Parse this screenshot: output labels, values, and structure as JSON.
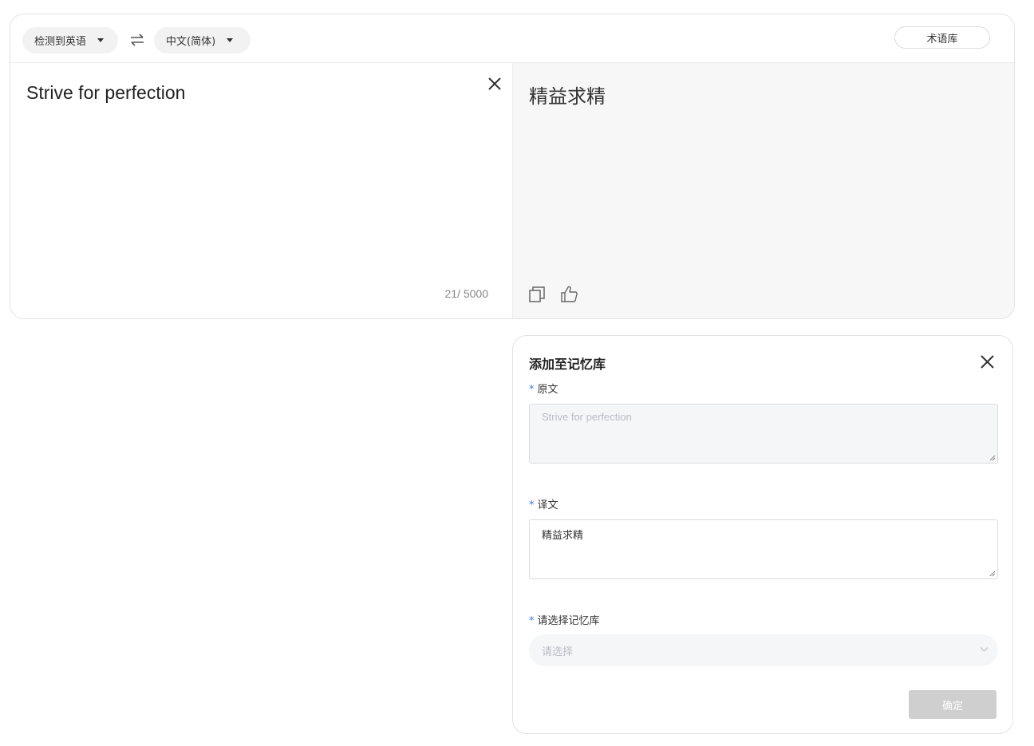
{
  "toolbar": {
    "source_language": "检测到英语",
    "target_language": "中文(简体)",
    "glossary_label": "术语库"
  },
  "source": {
    "text": "Strive for perfection",
    "counter": "21/ 5000"
  },
  "target": {
    "text": "精益求精"
  },
  "memory_panel": {
    "title": "添加至记忆库",
    "original_label": "原文",
    "original_value": "Strive for perfection",
    "translation_label": "译文",
    "translation_value": "精益求精",
    "library_label": "请选择记忆库",
    "library_placeholder": "请选择",
    "required_mark": "*",
    "confirm_label": "确定"
  },
  "icons": {
    "swap": "swap-icon",
    "clear": "close-icon",
    "copy": "copy-icon",
    "like": "thumbs-up-icon",
    "panel_close": "close-icon",
    "select": "chevron-down-icon"
  },
  "colors": {
    "accent": "#3b7cff",
    "target_background": "#f7f7f7",
    "disabled_button": "#cfcfcf"
  }
}
